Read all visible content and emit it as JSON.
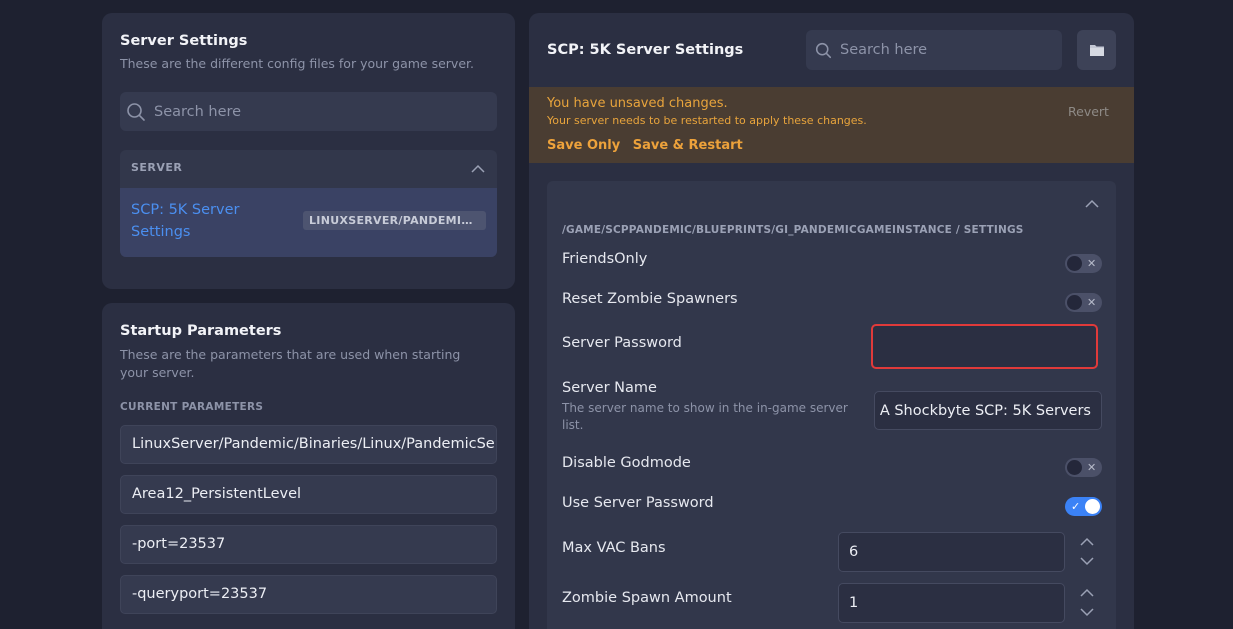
{
  "server_settings": {
    "title": "Server Settings",
    "subtitle": "These are the different config files for your game server.",
    "search_placeholder": "Search here",
    "group": {
      "heading": "SERVER",
      "item_label": "SCP: 5K Server Settings",
      "item_path": "LINUXSERVER/PANDEMIC/SAVED/CONFIG/LINUXSERVER/GAME.INI"
    }
  },
  "startup": {
    "title": "Startup Parameters",
    "subtitle": "These are the parameters that are used when starting your server.",
    "params_heading": "CURRENT PARAMETERS",
    "params": [
      "LinuxServer/Pandemic/Binaries/Linux/PandemicServer",
      "Area12_PersistentLevel",
      "-port=23537",
      "-queryport=23537"
    ]
  },
  "main": {
    "title": "SCP: 5K Server Settings",
    "search_placeholder": "Search here",
    "folder_icon": "folder-icon",
    "alert": {
      "title": "You have unsaved changes.",
      "subtitle": "Your server needs to be restarted to apply these changes.",
      "revert": "Revert",
      "save_only": "Save Only",
      "save_restart": "Save & Restart",
      "color": "#e8a43c"
    },
    "section_path": "/GAME/SCPPANDEMIC/BLUEPRINTS/GI_PANDEMICGAMEINSTANCE / SETTINGS",
    "settings": {
      "friends_only": {
        "label": "FriendsOnly",
        "enabled": false
      },
      "reset_zombie": {
        "label": "Reset Zombie Spawners",
        "enabled": false
      },
      "server_password": {
        "label": "Server Password",
        "value": ""
      },
      "server_name": {
        "label": "Server Name",
        "description": "The server name to show in the in-game server list.",
        "value": "A Shockbyte SCP: 5K Servers"
      },
      "disable_godmode": {
        "label": "Disable Godmode",
        "enabled": false
      },
      "use_password": {
        "label": "Use Server Password",
        "enabled": true
      },
      "max_vac_bans": {
        "label": "Max VAC Bans",
        "value": "6"
      },
      "zombie_spawn": {
        "label": "Zombie Spawn Amount",
        "value": "1"
      }
    },
    "toggle_off_mark": "✕",
    "toggle_on_mark": "✓"
  }
}
